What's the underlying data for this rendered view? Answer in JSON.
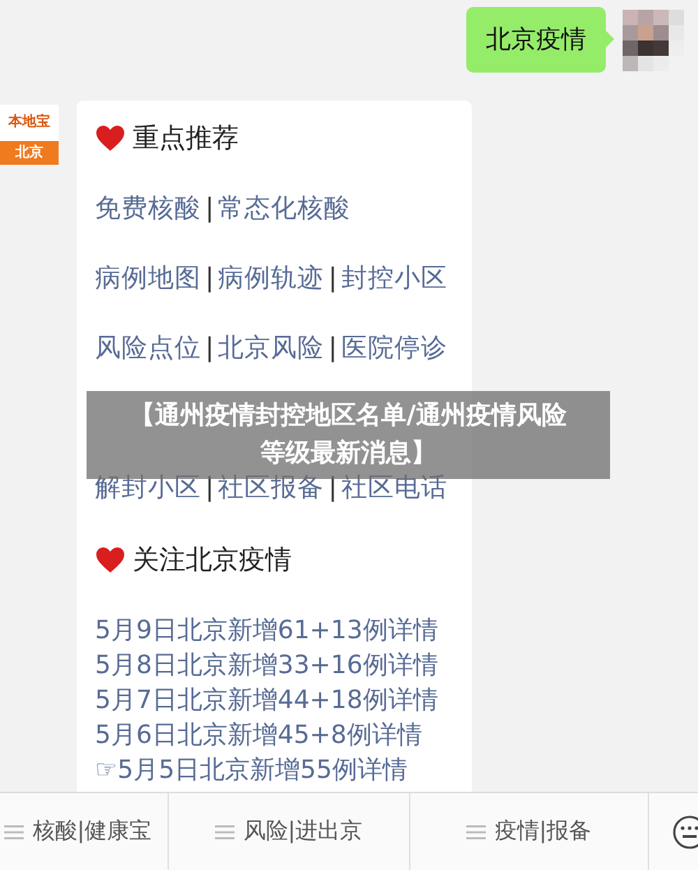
{
  "outgoing_message": {
    "text": "北京疫情"
  },
  "sender": {
    "logo_text": "本地宝",
    "city": "北京"
  },
  "card": {
    "sections": [
      {
        "title": "重点推荐",
        "rows": [
          [
            {
              "kind": "link",
              "text": "免费核酸"
            },
            {
              "kind": "sep",
              "text": "|"
            },
            {
              "kind": "link",
              "text": "常态化核酸"
            }
          ],
          [
            {
              "kind": "link",
              "text": "病例地图"
            },
            {
              "kind": "sep",
              "text": "|"
            },
            {
              "kind": "link",
              "text": "病例轨迹"
            },
            {
              "kind": "sep",
              "text": "|"
            },
            {
              "kind": "link",
              "text": "封控小区"
            }
          ],
          [
            {
              "kind": "link",
              "text": "风险点位"
            },
            {
              "kind": "sep",
              "text": "|"
            },
            {
              "kind": "link",
              "text": "北京风险"
            },
            {
              "kind": "sep",
              "text": "|"
            },
            {
              "kind": "link",
              "text": "医院停诊"
            }
          ],
          [],
          [
            {
              "kind": "link",
              "text": "解封小区"
            },
            {
              "kind": "sep",
              "text": "|"
            },
            {
              "kind": "link",
              "text": "社区报备"
            },
            {
              "kind": "sep",
              "text": "|"
            },
            {
              "kind": "link",
              "text": "社区电话"
            }
          ]
        ]
      },
      {
        "title": "关注北京疫情",
        "links": [
          "5月9日北京新增61+13例详情",
          "5月8日北京新增33+16例详情",
          "5月7日北京新增44+18例详情",
          "5月6日北京新增45+8例详情",
          "☞5月5日北京新增55例详情"
        ]
      }
    ]
  },
  "banner": {
    "text": "【通州疫情封控地区名单/通州疫情风险等级最新消息】"
  },
  "menu_bar": {
    "items": [
      "核酸|健康宝",
      "风险|进出京",
      "疫情|报备"
    ]
  }
}
